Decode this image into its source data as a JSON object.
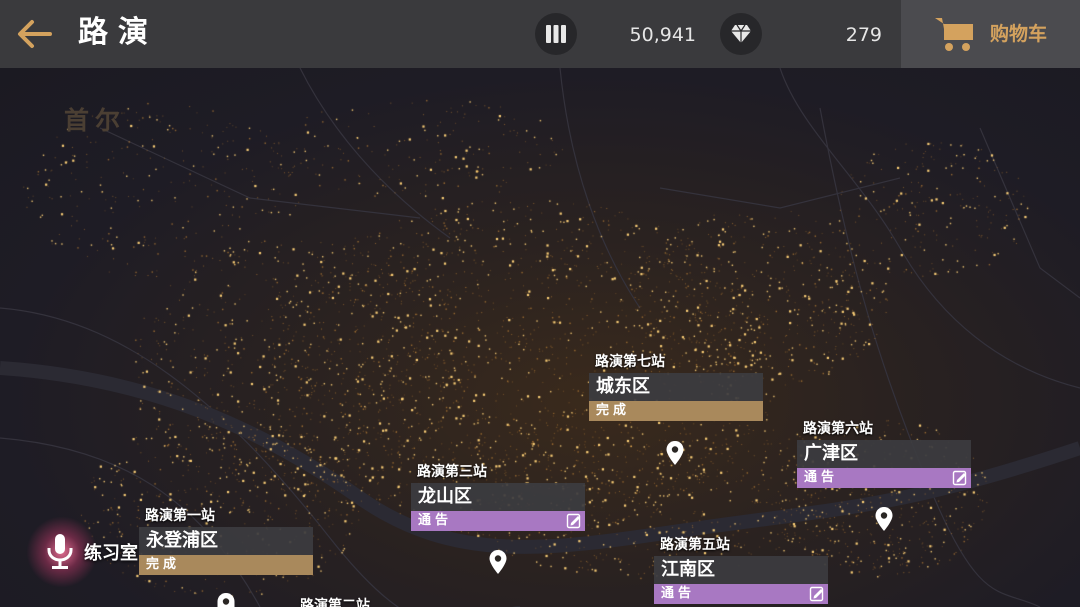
{
  "header": {
    "title": "路演",
    "currency_1": {
      "icon": "tickets-icon",
      "value": "50,941"
    },
    "currency_2": {
      "icon": "diamond-icon",
      "value": "279"
    },
    "cart_label": "购物车"
  },
  "map": {
    "city_label": "首尔"
  },
  "stages": [
    {
      "label": "路演第七站",
      "district": "城东区",
      "status": "完成",
      "state": "done"
    },
    {
      "label": "路演第六站",
      "district": "广津区",
      "status": "通告",
      "state": "notice"
    },
    {
      "label": "路演第三站",
      "district": "龙山区",
      "status": "通告",
      "state": "notice"
    },
    {
      "label": "路演第一站",
      "district": "永登浦区",
      "status": "完成",
      "state": "done"
    },
    {
      "label": "路演第五站",
      "district": "江南区",
      "status": "通告",
      "state": "notice"
    },
    {
      "label": "路演第二站",
      "district": "",
      "status": "",
      "state": ""
    }
  ],
  "practice": {
    "label": "练习室"
  },
  "colors": {
    "done": "#a9895c",
    "notice": "#a878c2",
    "accent": "#d4a25e"
  }
}
